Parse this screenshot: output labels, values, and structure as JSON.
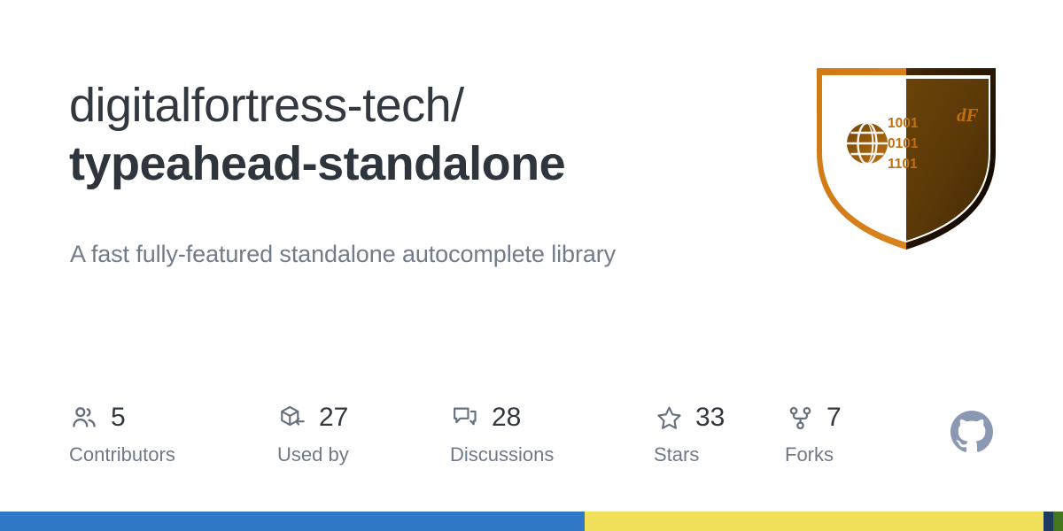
{
  "repository": {
    "owner": "digitalfortress-tech/",
    "name": "typeahead-standalone",
    "description": "A fast fully-featured standalone autocomplete library"
  },
  "stats": [
    {
      "icon": "people-icon",
      "count": "5",
      "label": "Contributors"
    },
    {
      "icon": "package-icon",
      "count": "27",
      "label": "Used by"
    },
    {
      "icon": "comment-icon",
      "count": "28",
      "label": "Discussions"
    },
    {
      "icon": "star-icon",
      "count": "33",
      "label": "Stars"
    },
    {
      "icon": "repo-forked-icon",
      "count": "7",
      "label": "Forks"
    }
  ],
  "brand": {
    "github_mark": "github-octocat-icon",
    "logo": {
      "name": "digitalfortress-shield-logo",
      "monogram": "dF",
      "binary_lines": [
        "1001",
        "0101",
        "1101"
      ],
      "globe": "globe-icon",
      "colors": {
        "orange_light": "#e38b1f",
        "orange": "#cb6f10",
        "brown_dark": "#5d3a09",
        "near_black": "#201203"
      }
    }
  },
  "colors": {
    "title": "#32383f",
    "description": "#707c8a",
    "stat_count": "#32383f",
    "stat_label": "#6f7a88",
    "icon": "#667180",
    "github_mark": "#8a98b4",
    "background": "#ffffff"
  },
  "language_bar": [
    {
      "name": "typescript-segment",
      "color": "#3178c6",
      "percent": 55.0
    },
    {
      "name": "javascript-segment",
      "color": "#f1e05a",
      "percent": 43.2
    },
    {
      "name": "navy-segment",
      "color": "#1f3a5f",
      "percent": 0.85
    },
    {
      "name": "green-segment",
      "color": "#44761f",
      "percent": 0.95
    }
  ]
}
